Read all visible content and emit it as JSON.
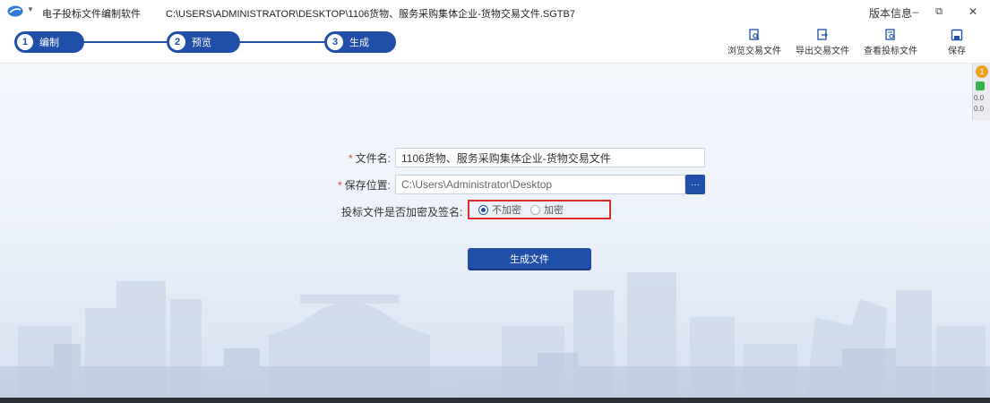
{
  "titlebar": {
    "app_name": "电子投标文件编制软件",
    "file_path": "C:\\USERS\\ADMINISTRATOR\\DESKTOP\\1106货物、服务采购集体企业-货物交易文件.SGTB7",
    "version_info": "版本信息",
    "minimize": "–",
    "restore": "⧉",
    "close": "✕"
  },
  "steps": [
    {
      "num": "1",
      "label": "编制"
    },
    {
      "num": "2",
      "label": "预览"
    },
    {
      "num": "3",
      "label": "生成"
    }
  ],
  "toolbar": {
    "browse_files": "浏览交易文件",
    "export_files": "导出交易文件",
    "view_bid": "查看投标文件",
    "save": "保存"
  },
  "form": {
    "filename_label": "文件名:",
    "filename_value": "1106货物、服务采购集体企业-货物交易文件",
    "save_location_label": "保存位置:",
    "save_location_value": "C:\\Users\\Administrator\\Desktop",
    "browse_button": "···",
    "encrypt_label": "投标文件是否加密及签名:",
    "no_encrypt": "不加密",
    "encrypt": "加密",
    "required_mark": "*"
  },
  "generate_button": "生成文件",
  "side_widget": {
    "badge": "1",
    "value1": "0.0",
    "value2": "0.0"
  },
  "colors": {
    "accent": "#1f4fa8",
    "highlight": "#e02b2b",
    "required": "#e0463a"
  }
}
